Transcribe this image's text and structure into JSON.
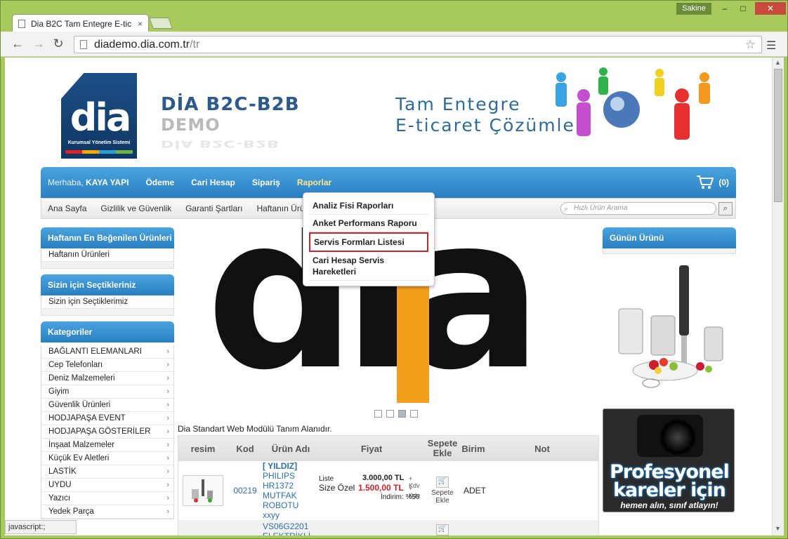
{
  "browser": {
    "tab_title": "Dia B2C Tam Entegre E-tic",
    "user_badge": "Sakine",
    "url_host": "diademo.dia.com.tr",
    "url_path": "/tr",
    "status": "javascript:;"
  },
  "header": {
    "logo_text": "dia",
    "logo_subtitle": "Kurumsal Yönetim Sistemi",
    "brand_line1": "DİA B2C-B2B",
    "brand_line2": "DEMO",
    "brand_reflection": "DİA B2C-B2B",
    "slogan_line1": "Tam Entegre",
    "slogan_line2": "E-ticaret Çözümleri"
  },
  "main_nav": {
    "greeting_prefix": "Merhaba,",
    "greeting_user": "KAYA YAPI",
    "items": [
      "Ödeme",
      "Cari Hesap",
      "Sipariş",
      "Raporlar"
    ],
    "cart_count": "(0)"
  },
  "sub_nav": {
    "items": [
      "Ana Sayfa",
      "Gizlilik ve Güvenlik",
      "Garanti Şartları",
      "Haftanın Ürünl"
    ],
    "search_placeholder": "Hızlı Ürün Arama"
  },
  "dropdown": {
    "items": [
      "Analiz Fisi Raporları",
      "Anket Performans Raporu",
      "Servis Formları Listesi",
      "Cari Hesap Servis Hareketleri"
    ]
  },
  "left": {
    "weekly_title": "Haftanın En Beğenilen Ürünleri",
    "weekly_item": "Haftanın Ürünleri",
    "picks_title": "Sizin için Seçtikleriniz",
    "picks_item": "Sizin için Seçtiklerimiz",
    "categories_title": "Kategoriler",
    "categories": [
      "BAĞLANTI ELEMANLARI",
      "Cep Telefonları",
      "Deniz Malzemeleri",
      "Giyim",
      "Güvenlik Ürünleri",
      "HODJAPAŞA EVENT",
      "HODJAPAŞA GÖSTERİLER",
      "İnşaat Malzemeler",
      "Küçük Ev Aletleri",
      "LASTİK",
      "UYDU",
      "Yazıcı",
      "Yedek Parça"
    ]
  },
  "center": {
    "slider_text": "dia",
    "module_title": "Dia Standart Web Modülü Tanım Alanıdır.",
    "table_headers": [
      "resim",
      "Kod",
      "Ürün Adı",
      "Fiyat",
      "Sepete Ekle",
      "Birim",
      "Not"
    ],
    "row1": {
      "code": "00219",
      "name_brand": "[ YILDIZ]",
      "name": "PHILIPS HR1372 MUTFAK ROBOTU",
      "name_extra": "xxyy",
      "price_label_list": "Liste",
      "price_label_special": "Size Özel",
      "price_list": "3.000,00 TL",
      "price_special": "1.500,00 TL",
      "kdv": "+ Kdv",
      "discount": "İndirim: %50",
      "add_label": "Sepete Ekle",
      "unit": "ADET"
    },
    "row2": {
      "name": "VS06G2201 ELEKTRİKLİ"
    }
  },
  "right": {
    "day_title": "Günün Ürünü",
    "ad_line1": "Profesyonel",
    "ad_line2": "kareler için",
    "ad_line3": "hemen alın, sınıf atlayın!"
  },
  "colors": {
    "nav_blue": "#2a7fc0",
    "accent_red": "#d0202a",
    "browser_green": "#a8c95c"
  }
}
